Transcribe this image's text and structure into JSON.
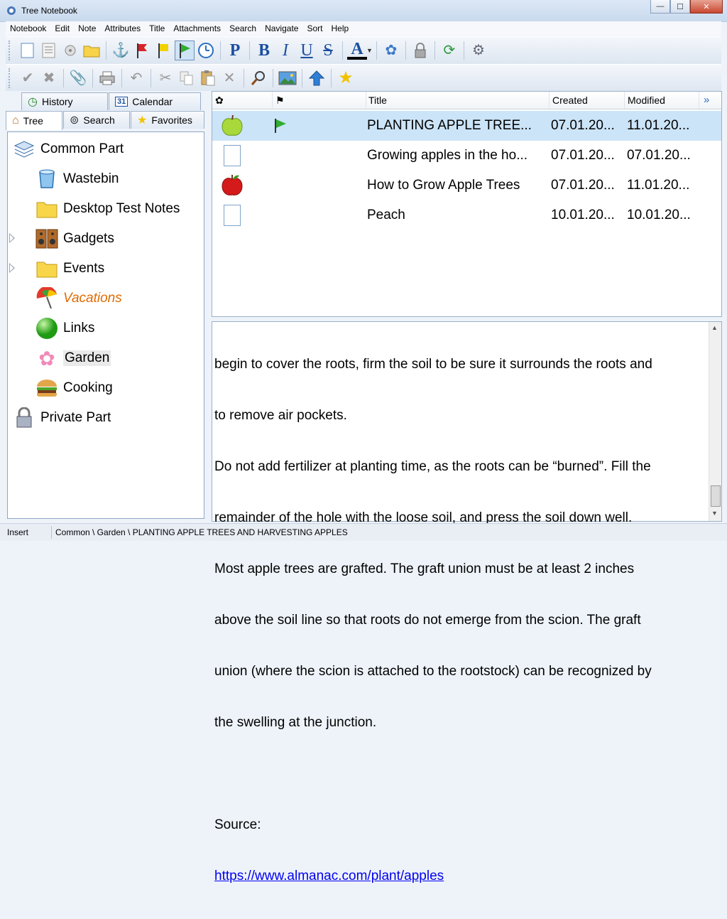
{
  "window": {
    "title": "Tree Notebook",
    "controls": [
      "—",
      "☐",
      "✕"
    ]
  },
  "menu": [
    "Notebook",
    "Edit",
    "Note",
    "Attributes",
    "Title",
    "Attachments",
    "Search",
    "Navigate",
    "Sort",
    "Help"
  ],
  "toolbar1": {
    "icons": [
      "new-note-icon",
      "text-note-icon",
      "disk-note-icon",
      "folder-icon",
      "anchor-icon",
      "red-flag-icon",
      "yellow-flag-icon",
      "green-flag-icon",
      "clock-icon",
      "paragraph-icon",
      "bold-icon",
      "italic-icon",
      "underline-icon",
      "strikethrough-icon",
      "font-color-icon",
      "flower-icon",
      "lock-icon",
      "sync-icon",
      "settings-icon"
    ],
    "paragraph": "P",
    "bold": "B",
    "italic": "I",
    "underline": "U",
    "strike": "S",
    "fontcolor": "A"
  },
  "toolbar2": {
    "icons": [
      "check-icon",
      "cross-icon",
      "paperclip-icon",
      "printer-icon",
      "undo-icon",
      "scissors-icon",
      "copy-icon",
      "paste-icon",
      "delete-icon",
      "magnifier-icon",
      "image-icon",
      "up-arrow-icon",
      "star-icon"
    ]
  },
  "left_tabs": {
    "top": [
      {
        "label": "History",
        "icon": "history-icon"
      },
      {
        "label": "Calendar",
        "icon": "calendar-icon",
        "badge": "31"
      }
    ],
    "bottom": [
      {
        "label": "Tree",
        "icon": "home-icon",
        "selected": true
      },
      {
        "label": "Search",
        "icon": "binoculars-icon"
      },
      {
        "label": "Favorites",
        "icon": "star-icon"
      }
    ]
  },
  "tree": [
    {
      "label": "Common Part",
      "icon": "layers-icon",
      "level": 0
    },
    {
      "label": "Wastebin",
      "icon": "wastebin-icon",
      "level": 1
    },
    {
      "label": "Desktop Test Notes",
      "icon": "folder-icon",
      "level": 1
    },
    {
      "label": "Gadgets",
      "icon": "speakers-icon",
      "level": 1,
      "expandable": true
    },
    {
      "label": "Events",
      "icon": "folder-icon",
      "level": 1,
      "expandable": true
    },
    {
      "label": "Vacations",
      "icon": "umbrella-icon",
      "level": 1,
      "style": "italic-orange"
    },
    {
      "label": "Links",
      "icon": "green-ball-icon",
      "level": 1
    },
    {
      "label": "Garden",
      "icon": "flower-icon",
      "level": 1,
      "highlighted": true
    },
    {
      "label": "Cooking",
      "icon": "burger-icon",
      "level": 1
    },
    {
      "label": "Private Part",
      "icon": "padlock-icon",
      "level": 0
    }
  ],
  "list": {
    "headers": {
      "icon_col": "✿",
      "flag_col": "⚑",
      "title": "Title",
      "created": "Created",
      "modified": "Modified"
    },
    "rows": [
      {
        "icon": "green-apple-icon",
        "flag": "green-flag-icon",
        "title": "PLANTING APPLE TREE...",
        "created": "07.01.20...",
        "modified": "11.01.20...",
        "selected": true
      },
      {
        "icon": "blank-note-icon",
        "flag": "",
        "title": "Growing apples in the ho...",
        "created": "07.01.20...",
        "modified": "07.01.20..."
      },
      {
        "icon": "red-apple-icon",
        "flag": "",
        "title": "How to Grow Apple Trees",
        "created": "07.01.20...",
        "modified": "11.01.20..."
      },
      {
        "icon": "blank-note-icon",
        "flag": "",
        "title": "Peach",
        "created": "10.01.20...",
        "modified": "10.01.20..."
      }
    ]
  },
  "editor": {
    "lines": [
      "begin to cover the roots, firm the soil to be sure it surrounds the roots and",
      "to remove air pockets.",
      "Do not add fertilizer at planting time, as the roots can be “burned”. Fill the",
      "remainder of the hole with the loose soil, and press the soil down well.",
      "Most apple trees are grafted. The graft union must be at least 2 inches",
      "above the soil line so that roots do not emerge from the scion. The graft",
      "union (where the scion is attached to the rootstock) can be recognized by",
      "the swelling at the junction.",
      "",
      "Source:"
    ],
    "link": "https://www.almanac.com/plant/apples"
  },
  "status": {
    "mode": "Insert",
    "path": "Common \\ Garden \\ PLANTING APPLE TREES AND HARVESTING APPLES"
  }
}
